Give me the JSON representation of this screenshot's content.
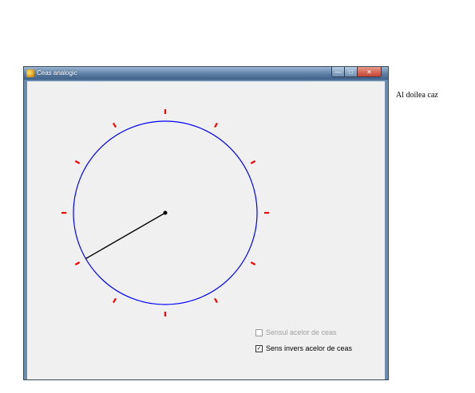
{
  "window": {
    "title": "Ceas analogic",
    "icon": "clock-app-icon",
    "controls": {
      "minimize": "minimize-icon",
      "maximize": "maximize-icon",
      "close": "close-icon"
    }
  },
  "clock": {
    "face_color": "#0000ff",
    "tick_color": "#ff0000",
    "hand_color": "#000000",
    "tick_count": 12,
    "hand_angle_deg": 240
  },
  "options": {
    "clockwise": {
      "label": "Sensul acelor de ceas",
      "checked": false,
      "enabled": false
    },
    "counterclockwise": {
      "label": "Sens invers acelor de ceas",
      "checked": true,
      "enabled": true
    }
  },
  "caption": "Al doilea caz"
}
